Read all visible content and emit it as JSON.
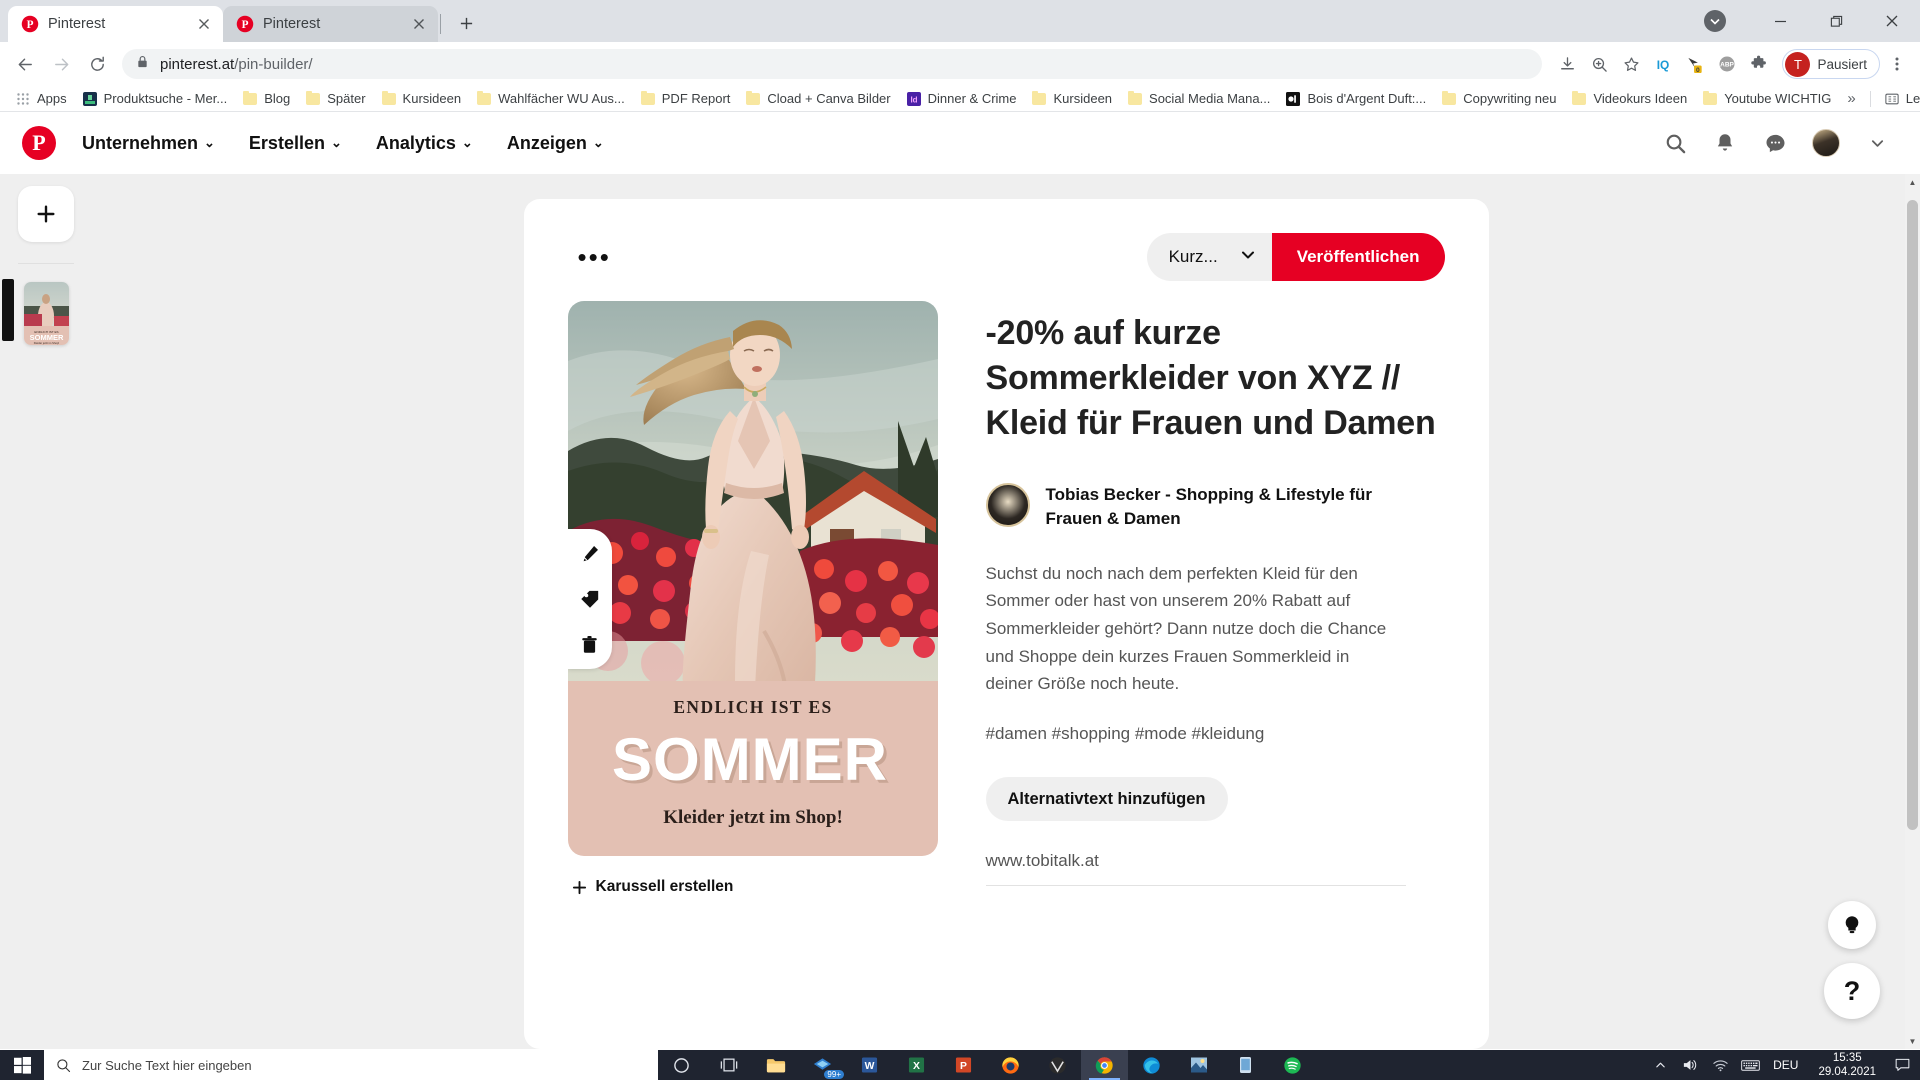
{
  "browser": {
    "tabs": [
      {
        "title": "Pinterest",
        "favicon": "pinterest-icon",
        "active": true
      },
      {
        "title": "Pinterest",
        "favicon": "pinterest-icon",
        "active": false
      }
    ],
    "new_tab_label": "+",
    "url_host": "pinterest.at",
    "url_path": "/pin-builder/",
    "profile_label": "Pausiert",
    "profile_initial": "T",
    "extensions": [
      "download-icon",
      "zoom-icon",
      "bookmark-star-icon",
      "iq-extension-icon",
      "grammarly-extension-icon",
      "adblock-plus-icon",
      "extensions-puzzle-icon"
    ],
    "bookmarks": [
      {
        "label": "Apps",
        "icon": "apps-grid-icon"
      },
      {
        "label": "Produktsuche - Mer...",
        "icon": "site-icon"
      },
      {
        "label": "Blog",
        "icon": "folder-icon"
      },
      {
        "label": "Später",
        "icon": "folder-icon"
      },
      {
        "label": "Kursideen",
        "icon": "folder-icon"
      },
      {
        "label": "Wahlfächer WU Aus...",
        "icon": "folder-icon"
      },
      {
        "label": "PDF Report",
        "icon": "folder-icon"
      },
      {
        "label": "Cload + Canva Bilder",
        "icon": "folder-icon"
      },
      {
        "label": "Dinner & Crime",
        "icon": "indesign-icon"
      },
      {
        "label": "Kursideen",
        "icon": "folder-icon"
      },
      {
        "label": "Social Media Mana...",
        "icon": "folder-icon"
      },
      {
        "label": "Bois d'Argent Duft:...",
        "icon": "dark-site-icon"
      },
      {
        "label": "Copywriting neu",
        "icon": "folder-icon"
      },
      {
        "label": "Videokurs Ideen",
        "icon": "folder-icon"
      },
      {
        "label": "Youtube WICHTIG",
        "icon": "folder-icon"
      }
    ],
    "bookmarks_overflow": "»",
    "reading_list": "Leseliste"
  },
  "pinterest": {
    "nav": [
      {
        "label": "Unternehmen",
        "has_chevron": true
      },
      {
        "label": "Erstellen",
        "has_chevron": true
      },
      {
        "label": "Analytics",
        "has_chevron": true
      },
      {
        "label": "Anzeigen",
        "has_chevron": true
      }
    ],
    "header_icons": [
      "search-icon",
      "bell-icon",
      "messages-icon",
      "avatar",
      "chevron-down-icon"
    ],
    "rail": {
      "add_label": "+"
    },
    "card": {
      "more_options": "•••",
      "board_select": "Kurz...",
      "publish_label": "Veröffentlichen",
      "tools": [
        "edit-pencil-icon",
        "tag-icon",
        "trash-icon"
      ],
      "carousel_label": "Karussell erstellen",
      "pin_overlay": {
        "line1": "ENDLICH IST ES",
        "line2": "SOMMER",
        "line3": "Kleider jetzt im Shop!"
      },
      "title": "-20% auf kurze Sommerkleider von XYZ // Kleid für Frauen und Damen",
      "author": "Tobias Becker - Shopping & Lifestyle für Frauen & Damen",
      "description": "Suchst du noch nach dem perfekten Kleid für den Sommer oder hast von unserem 20% Rabatt auf Sommerkleider gehört? Dann nutze doch die Chance und Shoppe dein kurzes Frauen Sommerkleid in deiner Größe noch heute.",
      "tags": "#damen #shopping #mode #kleidung",
      "alt_text_label": "Alternativtext hinzufügen",
      "destination_url": "www.tobitalk.at"
    },
    "fabs": [
      "idea-bulb-icon",
      "help-question-icon"
    ],
    "accent_color": "#e60023"
  },
  "taskbar": {
    "search_placeholder": "Zur Suche Text hier eingeben",
    "apps": [
      {
        "name": "cortana-icon"
      },
      {
        "name": "task-view-icon"
      },
      {
        "name": "file-explorer-icon"
      },
      {
        "name": "onedrive-icon",
        "badge": "99+"
      },
      {
        "name": "word-icon"
      },
      {
        "name": "excel-icon"
      },
      {
        "name": "powerpoint-icon"
      },
      {
        "name": "firefox-icon"
      },
      {
        "name": "vivaldi-icon"
      },
      {
        "name": "chrome-icon",
        "active": true
      },
      {
        "name": "edge-icon"
      },
      {
        "name": "photos-icon"
      },
      {
        "name": "phone-link-icon"
      },
      {
        "name": "spotify-icon"
      }
    ],
    "tray": [
      "show-hidden-icons",
      "volume-icon",
      "wifi-icon",
      "keyboard-icon"
    ],
    "language": "DEU",
    "time": "15:35",
    "date": "29.04.2021"
  }
}
